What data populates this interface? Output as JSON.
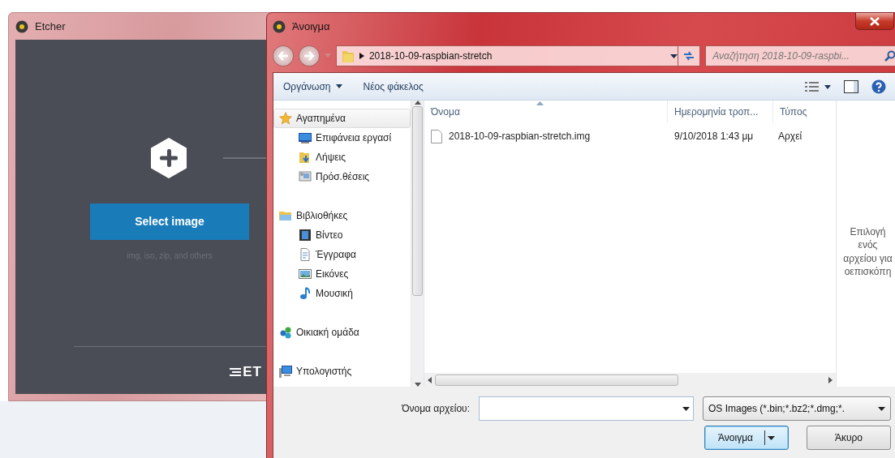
{
  "etcher_window": {
    "title": "Etcher",
    "select_button": "Select image",
    "hint": "img, iso, zip, and others",
    "logo_text": "ET"
  },
  "dialog": {
    "title": "Άνοιγμα",
    "breadcrumb": "2018-10-09-raspbian-stretch",
    "search": {
      "placeholder": "Αναζήτηση 2018-10-09-raspbi..."
    },
    "toolbar": [
      {
        "label": "Οργάνωση",
        "kind": "menu"
      },
      {
        "label": "Νέος φάκελος",
        "kind": "button"
      }
    ],
    "nav": [
      {
        "label": "Αγαπημένα",
        "kind": "favorites",
        "selected": true,
        "children": [
          {
            "label": "Επιφάνεια εργασί",
            "kind": "desktop",
            "selected": false
          },
          {
            "label": "Λήψεις",
            "kind": "downloads",
            "selected": false
          },
          {
            "label": "Πρόσ.θέσεις",
            "kind": "places",
            "selected": false
          }
        ]
      },
      {
        "label": "Βιβλιοθήκες",
        "kind": "libraries",
        "selected": false,
        "children": [
          {
            "label": "Βίντεο",
            "kind": "video",
            "selected": false
          },
          {
            "label": "Έγγραφα",
            "kind": "documents",
            "selected": false
          },
          {
            "label": "Εικόνες",
            "kind": "pictures",
            "selected": false
          },
          {
            "label": "Μουσική",
            "kind": "music",
            "selected": false
          }
        ]
      },
      {
        "label": "Οικιακή ομάδα",
        "kind": "homegroup",
        "selected": false
      },
      {
        "label": "Υπολογιστής",
        "kind": "computer",
        "selected": false
      }
    ],
    "columns": [
      {
        "label": "Όνομα",
        "sorted": true
      },
      {
        "label": "Ημερομηνία τροπ...",
        "sorted": false
      },
      {
        "label": "Τύπος",
        "sorted": false
      }
    ],
    "files": [
      {
        "name": "2018-10-09-raspbian-stretch.img",
        "date": "9/10/2018 1:43 μμ",
        "type": "Αρχεί",
        "selected": false
      }
    ],
    "preview_hint_lines": [
      "Επιλογή",
      "ενός",
      "αρχείου για",
      "οεπισκόπη"
    ],
    "filename_label": "Όνομα αρχείου:",
    "filter": "OS Images (*.bin;*.bz2;*.dmg;*.",
    "buttons": [
      {
        "label": "Άνοιγμα",
        "kind": "split",
        "default": true
      },
      {
        "label": "Άκυρο",
        "kind": "plain",
        "default": false
      }
    ]
  }
}
